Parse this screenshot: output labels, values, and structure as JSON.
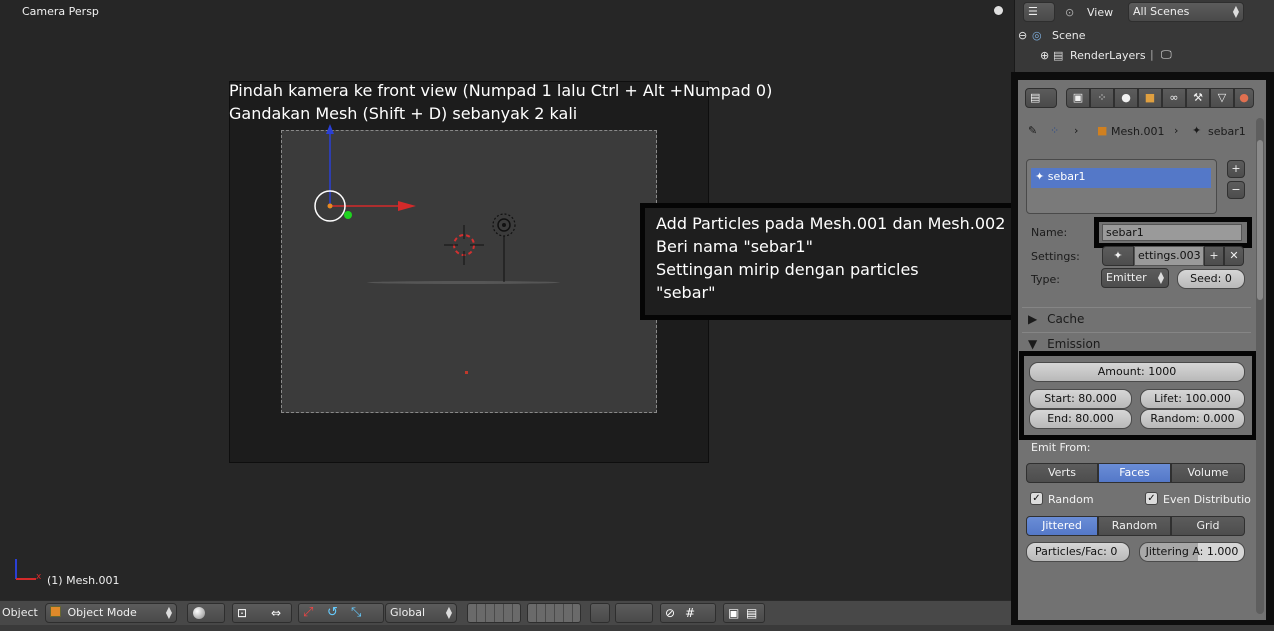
{
  "viewport": {
    "title": "Camera Persp",
    "object_label": "(1) Mesh.001",
    "annotation_top": [
      "Pindah kamera ke front view (Numpad 1 lalu Ctrl + Alt +Numpad 0)",
      "Gandakan Mesh (Shift + D) sebanyak 2 kali"
    ],
    "annotation_right": [
      "Add Particles pada Mesh.001 dan Mesh.002",
      "Beri nama \"sebar1\"",
      "Settingan mirip dengan particles",
      "\"sebar\""
    ]
  },
  "header": {
    "mode_label": "Object",
    "mode_select": "Object Mode",
    "orientation": "Global"
  },
  "outliner": {
    "view_label": "View",
    "scenes_select": "All Scenes",
    "tree": [
      "Scene",
      "RenderLayers"
    ]
  },
  "properties": {
    "breadcrumb": [
      "Mesh.001",
      "sebar1"
    ],
    "particle_systems": [
      "sebar1"
    ],
    "name_label": "Name:",
    "name_value": "sebar1",
    "settings_label": "Settings:",
    "settings_value": "ettings.003",
    "type_label": "Type:",
    "type_value": "Emitter",
    "seed": "Seed: 0",
    "panels": {
      "cache": "Cache",
      "emission": "Emission"
    },
    "amount": "Amount: 1000",
    "start": "Start: 80.000",
    "end": "End: 80.000",
    "lifetime": "Lifet: 100.000",
    "random": "Random: 0.000",
    "emit_from_label": "Emit From:",
    "emit_from": [
      "Verts",
      "Faces",
      "Volume"
    ],
    "emit_from_active": "Faces",
    "random_check": "Random",
    "even_check": "Even Distributio",
    "distribution": [
      "Jittered",
      "Random",
      "Grid"
    ],
    "distribution_active": "Jittered",
    "particles_face": "Particles/Fac: 0",
    "jittering": "Jittering A: 1.000"
  },
  "colors": {
    "accent_blue": "#5478c8",
    "viewport_bg": "#262626",
    "panel_bg": "#727272"
  }
}
